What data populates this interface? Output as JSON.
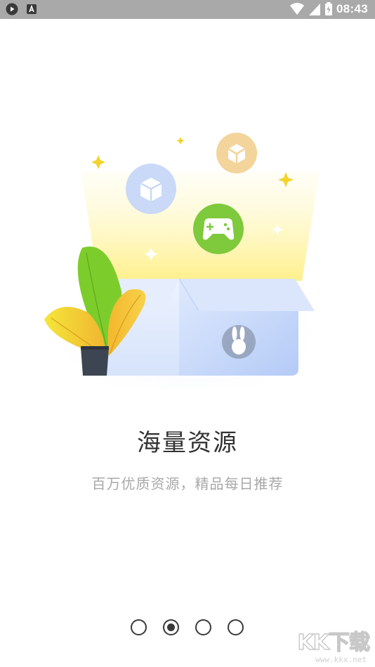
{
  "status_bar": {
    "time": "08:43",
    "left_icons": [
      "play-store-icon",
      "font-a-icon"
    ],
    "right_icons": [
      "wifi-icon",
      "signal-icon",
      "battery-icon"
    ]
  },
  "onboarding": {
    "title": "海量资源",
    "subtitle": "百万优质资源，精品每日推荐",
    "page_count": 4,
    "current_page": 2,
    "illustration_icons": [
      "cube-icon",
      "cube-icon",
      "gamepad-icon",
      "rabbit-logo-icon",
      "plant-icon",
      "sparkle-icon"
    ]
  },
  "watermark": {
    "logo": "KK下载",
    "url": "www.kkx.net"
  },
  "colors": {
    "status_bar": "#a9a9a9",
    "gamepad_green": "#7cc93a",
    "cube_blue": "#c7d8f7",
    "cube_orange": "#f2d294",
    "box_blue": "#d4e2fb",
    "glow_yellow": "#fff29a"
  }
}
